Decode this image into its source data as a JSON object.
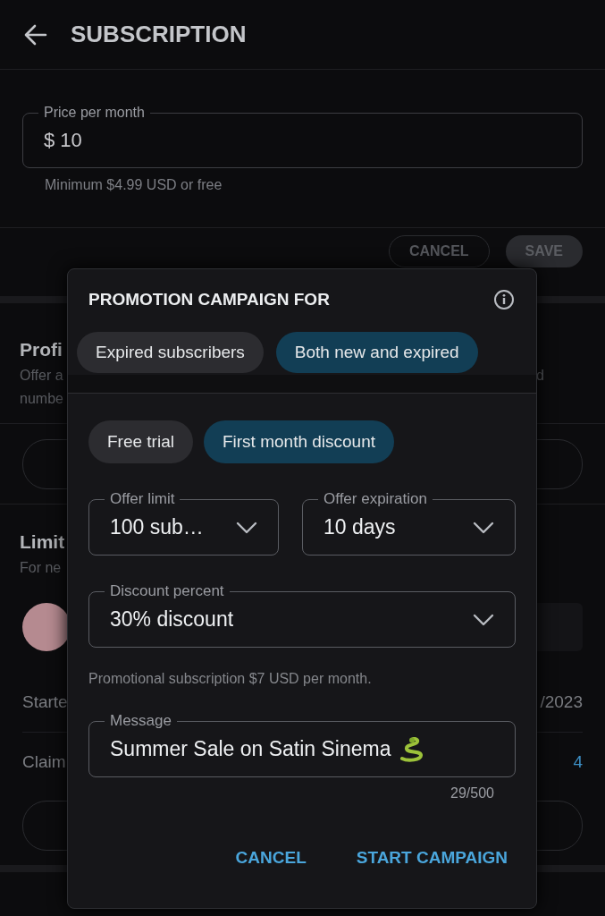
{
  "header": {
    "title": "SUBSCRIPTION"
  },
  "price_field": {
    "label": "Price per month",
    "value": "$ 10",
    "helper": "Minimum $4.99 USD or free"
  },
  "price_actions": [
    {
      "label": "CANCEL",
      "kind": "outlined"
    },
    {
      "label": "SAVE",
      "kind": "filled"
    }
  ],
  "profile_section": {
    "title": "Profi",
    "lines": [
      {
        "left": "Offer a",
        "right": "d"
      },
      {
        "left": "numbe"
      }
    ]
  },
  "limited_section": {
    "title": "Limit",
    "subtitle": "For ne",
    "rows": [
      {
        "label": "Starte",
        "value": "/2023",
        "kind": "plain"
      },
      {
        "label": "Claim",
        "value": "4",
        "kind": "link"
      }
    ]
  },
  "dialog": {
    "title": "PROMOTION CAMPAIGN FOR",
    "audience_options": [
      {
        "label": "Expired subscribers",
        "selected": false
      },
      {
        "label": "Both new and expired",
        "selected": true
      }
    ],
    "offer_types": [
      {
        "label": "Free trial",
        "selected": false
      },
      {
        "label": "First month discount",
        "selected": true
      }
    ],
    "selects": [
      {
        "label": "Offer limit",
        "value": "100 sub…"
      },
      {
        "label": "Offer expiration",
        "value": "10 days"
      }
    ],
    "discount_select": {
      "label": "Discount percent",
      "value": "30% discount"
    },
    "summary": "Promotional subscription $7 USD per month.",
    "message_field": {
      "label": "Message",
      "value": "Summer Sale on Satin Sinema",
      "counter": "29/500"
    },
    "actions": [
      "CANCEL",
      "START CAMPAIGN"
    ]
  }
}
